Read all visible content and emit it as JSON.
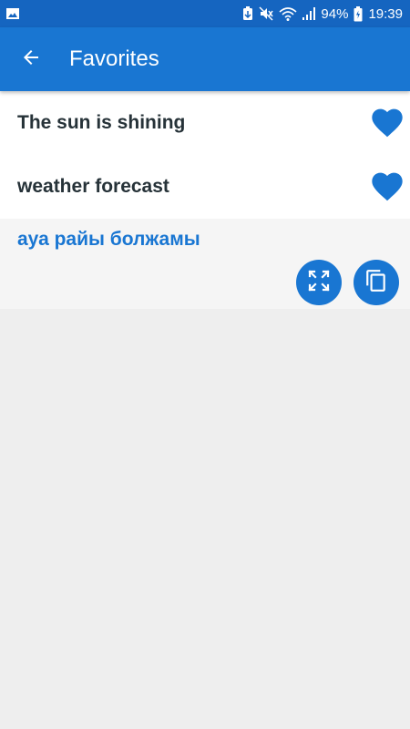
{
  "status_bar": {
    "battery_percent": "94%",
    "time": "19:39",
    "icons": [
      "gallery-icon",
      "battery-saver-icon",
      "mute-icon",
      "wifi-icon",
      "signal-icon",
      "battery-icon"
    ]
  },
  "app_bar": {
    "title": "Favorites",
    "back_icon": "arrow-left-icon"
  },
  "favorites": [
    {
      "text": "The sun is shining",
      "icon": "heart-icon"
    },
    {
      "text": "weather forecast",
      "icon": "heart-icon"
    }
  ],
  "translation_panel": {
    "text": "ауа райы болжамы",
    "actions": [
      {
        "name": "expand-button",
        "icon": "fullscreen-icon"
      },
      {
        "name": "copy-button",
        "icon": "copy-icon"
      }
    ]
  },
  "colors": {
    "status_bar": "#1565c0",
    "app_bar": "#1976d2",
    "accent": "#1976d2",
    "row_text": "#263238",
    "background": "#eeeeee"
  }
}
